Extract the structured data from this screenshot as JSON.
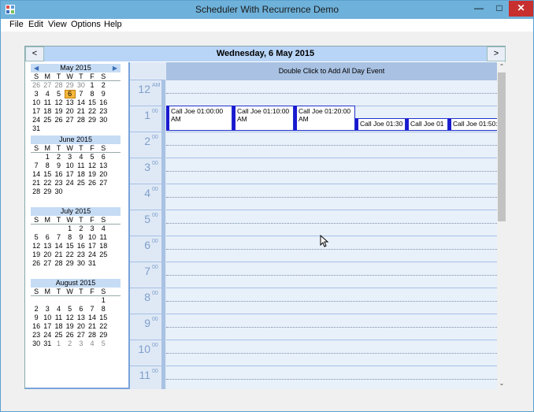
{
  "window": {
    "title": "Scheduler With Recurrence Demo"
  },
  "menu": [
    "File",
    "Edit",
    "View",
    "Options",
    "Help"
  ],
  "nav": {
    "prev": "<",
    "next": ">",
    "date_title": "Wednesday, 6 May 2015"
  },
  "allday_hint": "Double Click to Add All Day Event",
  "months": [
    {
      "name": "May 2015",
      "dow": [
        "S",
        "M",
        "T",
        "W",
        "T",
        "F",
        "S"
      ],
      "weeks": [
        [
          "26",
          "27",
          "28",
          "29",
          "30",
          "1",
          "2"
        ],
        [
          "3",
          "4",
          "5",
          "6",
          "7",
          "8",
          "9"
        ],
        [
          "10",
          "11",
          "12",
          "13",
          "14",
          "15",
          "16"
        ],
        [
          "17",
          "18",
          "19",
          "20",
          "21",
          "22",
          "23"
        ],
        [
          "24",
          "25",
          "26",
          "27",
          "28",
          "29",
          "30"
        ],
        [
          "31",
          "",
          "",
          "",
          "",
          "",
          ""
        ]
      ],
      "today": "6"
    },
    {
      "name": "June 2015",
      "dow": [
        "S",
        "M",
        "T",
        "W",
        "T",
        "F",
        "S"
      ],
      "weeks": [
        [
          "",
          "1",
          "2",
          "3",
          "4",
          "5",
          "6"
        ],
        [
          "7",
          "8",
          "9",
          "10",
          "11",
          "12",
          "13"
        ],
        [
          "14",
          "15",
          "16",
          "17",
          "18",
          "19",
          "20"
        ],
        [
          "21",
          "22",
          "23",
          "24",
          "25",
          "26",
          "27"
        ],
        [
          "28",
          "29",
          "30",
          "",
          "",
          "",
          ""
        ]
      ]
    },
    {
      "name": "July 2015",
      "dow": [
        "S",
        "M",
        "T",
        "W",
        "T",
        "F",
        "S"
      ],
      "weeks": [
        [
          "",
          "",
          "",
          "1",
          "2",
          "3",
          "4"
        ],
        [
          "5",
          "6",
          "7",
          "8",
          "9",
          "10",
          "11"
        ],
        [
          "12",
          "13",
          "14",
          "15",
          "16",
          "17",
          "18"
        ],
        [
          "19",
          "20",
          "21",
          "22",
          "23",
          "24",
          "25"
        ],
        [
          "26",
          "27",
          "28",
          "29",
          "30",
          "31",
          ""
        ]
      ]
    },
    {
      "name": "August 2015",
      "dow": [
        "S",
        "M",
        "T",
        "W",
        "T",
        "F",
        "S"
      ],
      "weeks": [
        [
          "",
          "",
          "",
          "",
          "",
          "",
          "1"
        ],
        [
          "2",
          "3",
          "4",
          "5",
          "6",
          "7",
          "8"
        ],
        [
          "9",
          "10",
          "11",
          "12",
          "13",
          "14",
          "15"
        ],
        [
          "16",
          "17",
          "18",
          "19",
          "20",
          "21",
          "22"
        ],
        [
          "23",
          "24",
          "25",
          "26",
          "27",
          "28",
          "29"
        ],
        [
          "30",
          "31",
          "1",
          "2",
          "3",
          "4",
          "5"
        ]
      ],
      "trailing_other": 5
    }
  ],
  "hours": [
    {
      "num": "12",
      "sup": "AM"
    },
    {
      "num": "1",
      "sup": "00"
    },
    {
      "num": "2",
      "sup": "00"
    },
    {
      "num": "3",
      "sup": "00"
    },
    {
      "num": "4",
      "sup": "00"
    },
    {
      "num": "5",
      "sup": "00"
    },
    {
      "num": "6",
      "sup": "00"
    },
    {
      "num": "7",
      "sup": "00"
    },
    {
      "num": "8",
      "sup": "00"
    },
    {
      "num": "9",
      "sup": "00"
    },
    {
      "num": "10",
      "sup": "00"
    },
    {
      "num": "11",
      "sup": "00"
    }
  ],
  "events": [
    {
      "text": "Call Joe 01:00:00 AM"
    },
    {
      "text": "Call Joe 01:10:00 AM"
    },
    {
      "text": "Call Joe 01:20:00 AM"
    },
    {
      "text": "Call Joe 01:30"
    },
    {
      "text": "Call Joe 01"
    },
    {
      "text": "Call Joe 01:50:"
    }
  ],
  "icons": {
    "app": "app-grid-icon",
    "minimize": "minimize-icon",
    "maximize": "maximize-icon",
    "close": "close-icon",
    "scroll_up": "chevron-up-icon",
    "scroll_down": "chevron-down-icon"
  },
  "colors": {
    "titlebar": "#6eb1da",
    "date_header": "#b8d4f6",
    "today": "#f6b73c",
    "event_border": "#1a1acf",
    "close": "#c7302e"
  }
}
